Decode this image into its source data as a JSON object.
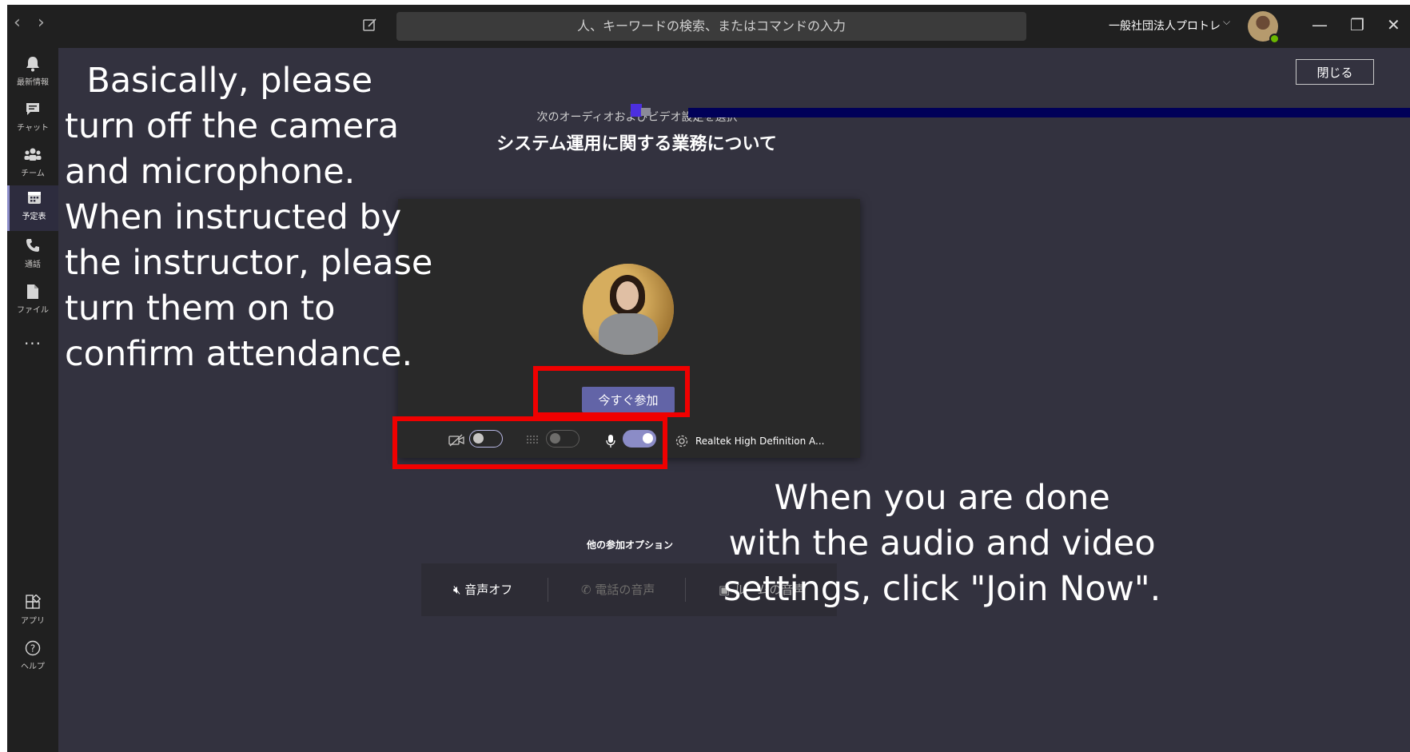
{
  "window": {
    "search_placeholder": "人、キーワードの検索、またはコマンドの入力",
    "org_name": "一般社団法人プロトレ",
    "org_chevron": "⌵",
    "nav_back": "‹",
    "nav_forward": "›",
    "minimize": "—",
    "maximize": "❐",
    "close": "✕"
  },
  "rail": {
    "items": [
      {
        "label": "最新情報",
        "icon": "bell-icon"
      },
      {
        "label": "チャット",
        "icon": "chat-icon"
      },
      {
        "label": "チーム",
        "icon": "teams-icon"
      },
      {
        "label": "予定表",
        "icon": "calendar-icon"
      },
      {
        "label": "通話",
        "icon": "phone-icon"
      },
      {
        "label": "ファイル",
        "icon": "file-icon"
      }
    ],
    "more": "···",
    "apps_label": "アプリ",
    "help_label": "ヘルプ"
  },
  "prejoin": {
    "close_label": "閉じる",
    "prompt": "次のオーディオおよびビデオ設定を選択",
    "meeting_title": "システム運用に関する業務について",
    "join_label": "今すぐ参加",
    "device_name": "Realtek High Definition A...",
    "camera_on": false,
    "blur_on": false,
    "mic_on": true
  },
  "other_options": {
    "title": "他の参加オプション",
    "audio_off": "音声オフ",
    "phone_audio": "電話の音声",
    "room_audio": "ルームの音声"
  },
  "annotations": {
    "left": "  Basically, please\nturn off the camera\nand microphone.\nWhen instructed by\nthe instructor, please\nturn them on to\nconfirm attendance.",
    "right": "When you are done\nwith the audio and video\nsettings, click \"Join Now\"."
  },
  "colors": {
    "accent": "#6264a7",
    "highlight": "#f00000",
    "background": "#33323f",
    "rail": "#202020"
  }
}
